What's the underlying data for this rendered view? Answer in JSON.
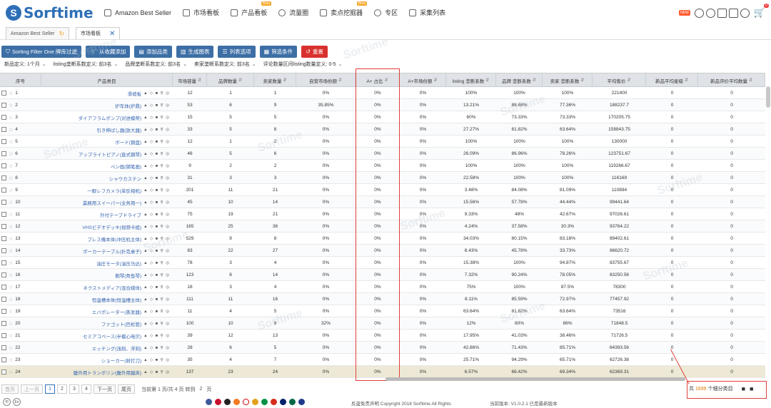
{
  "app": {
    "logo": "Sorftime"
  },
  "nav": [
    {
      "label": "Amazon Best Seller",
      "beta": ""
    },
    {
      "label": "市场看板",
      "beta": ""
    },
    {
      "label": "产品看板",
      "beta": "Beta"
    },
    {
      "label": "流量圈",
      "beta": ""
    },
    {
      "label": "卖点挖掘器",
      "beta": "Beta"
    },
    {
      "label": "专区",
      "beta": ""
    },
    {
      "label": "采集列表",
      "beta": ""
    }
  ],
  "top_right": {
    "new_badge": "NEW",
    "cart_count": "0"
  },
  "tabs": [
    {
      "label": "Amazon Best Seller"
    },
    {
      "label": "市场看板"
    }
  ],
  "toolbar": [
    {
      "label": "Sorting Filter One 牌库过滤",
      "icon": "funnel-icon"
    },
    {
      "label": "从收藏添加",
      "icon": "cart-icon"
    },
    {
      "label": "添加品类",
      "icon": "list-icon"
    },
    {
      "label": "生成图表",
      "icon": "chart-icon"
    },
    {
      "label": "列表选项",
      "icon": "list-icon"
    },
    {
      "label": "筛选条件",
      "icon": "filter-icon"
    },
    {
      "label": "重置",
      "icon": "reset-icon"
    }
  ],
  "filters": [
    {
      "label": "新品定义:",
      "value": "1个月"
    },
    {
      "label": "listing垄断系数定义:",
      "value": "前3名"
    },
    {
      "label": "品牌垄断系数定义:",
      "value": "前3名"
    },
    {
      "label": "卖家垄断系数定义:",
      "value": "前3名"
    },
    {
      "label": "评论数量区间listing数量定义:",
      "value": "0-5"
    }
  ],
  "columns": [
    "序号",
    "产品类目",
    "市场容量",
    "品牌数量",
    "卖家数量",
    "自营市场份额",
    "A+ 占比",
    "A+市场份额",
    "listing 垄断系数",
    "品牌 垄断系数",
    "卖家 垄断系数",
    "平均售价",
    "新品平均星级",
    "新品评价平均数量"
  ],
  "rows": [
    [
      "1",
      "滑坡板",
      "12",
      "1",
      "1",
      "0%",
      "0%",
      "0%",
      "100%",
      "100%",
      "100%",
      "221400",
      "0",
      "0"
    ],
    [
      "2",
      "炉车体(炉鼎)",
      "53",
      "6",
      "9",
      "35.85%",
      "0%",
      "0%",
      "13.21%",
      "88.68%",
      "77.36%",
      "188237.7",
      "0",
      "0"
    ],
    [
      "3",
      "ダイアフラムポンプ(对进模帮)",
      "15",
      "5",
      "5",
      "0%",
      "0%",
      "0%",
      "60%",
      "73.33%",
      "73.33%",
      "170205.75",
      "0",
      "0"
    ],
    [
      "4",
      "引き伸ばし器(放大器)",
      "33",
      "5",
      "8",
      "0%",
      "0%",
      "0%",
      "27.27%",
      "81.82%",
      "63.64%",
      "158843.75",
      "0",
      "0"
    ],
    [
      "5",
      "ボード(钢盘)",
      "12",
      "1",
      "2",
      "0%",
      "0%",
      "0%",
      "100%",
      "100%",
      "100%",
      "130000",
      "0",
      "0"
    ],
    [
      "6",
      "アップライトピアノ(直式钢琴)",
      "46",
      "5",
      "6",
      "0%",
      "0%",
      "0%",
      "26.09%",
      "86.96%",
      "78.26%",
      "123751.67",
      "0",
      "0"
    ],
    [
      "7",
      "ペン画(钢笔画)",
      "9",
      "2",
      "2",
      "0%",
      "0%",
      "0%",
      "100%",
      "100%",
      "100%",
      "119266.67",
      "0",
      "0"
    ],
    [
      "8",
      "シャウカステン",
      "31",
      "3",
      "3",
      "0%",
      "0%",
      "0%",
      "22.58%",
      "100%",
      "100%",
      "116169",
      "0",
      "0"
    ],
    [
      "9",
      "一眼レフカメラ(单反相机)",
      "201",
      "11",
      "21",
      "0%",
      "0%",
      "0%",
      "3.48%",
      "84.08%",
      "81.09%",
      "110894",
      "0",
      "0"
    ],
    [
      "10",
      "業務用スイーパー(业务用一)",
      "45",
      "10",
      "14",
      "0%",
      "0%",
      "0%",
      "15.56%",
      "57.78%",
      "44.44%",
      "99441.64",
      "0",
      "0"
    ],
    [
      "11",
      "外付テープドライブ",
      "75",
      "19",
      "21",
      "0%",
      "0%",
      "0%",
      "9.33%",
      "48%",
      "42.67%",
      "97026.61",
      "0",
      "0"
    ],
    [
      "12",
      "VHSビデオデッキ(视频卡组)",
      "165",
      "25",
      "36",
      "0%",
      "0%",
      "0%",
      "4.24%",
      "37.58%",
      "30.3%",
      "93764.22",
      "0",
      "0"
    ],
    [
      "13",
      "プレス機本体(冲压机主体)",
      "529",
      "9",
      "8",
      "0%",
      "0%",
      "0%",
      "34.03%",
      "80.15%",
      "83.18%",
      "89402.61",
      "0",
      "0"
    ],
    [
      "14",
      "ポーカーテーブル(扑克桌子)",
      "83",
      "22",
      "27",
      "0%",
      "0%",
      "0%",
      "8.43%",
      "45.78%",
      "33.73%",
      "86620.72",
      "0",
      "0"
    ],
    [
      "15",
      "油圧モータ(油压马达)",
      "78",
      "3",
      "4",
      "0%",
      "0%",
      "0%",
      "15.38%",
      "100%",
      "94.87%",
      "83755.67",
      "0",
      "0"
    ],
    [
      "16",
      "鞄琴(骨鱼琴)",
      "123",
      "8",
      "14",
      "0%",
      "0%",
      "0%",
      "7.32%",
      "90.24%",
      "78.05%",
      "83250.56",
      "0",
      "0"
    ],
    [
      "17",
      "ネクストメディア(混合媒体)",
      "18",
      "3",
      "4",
      "0%",
      "0%",
      "0%",
      "75%",
      "100%",
      "87.5%",
      "78300",
      "0",
      "0"
    ],
    [
      "18",
      "恒温槽本体(恒温槽主体)",
      "111",
      "11",
      "16",
      "0%",
      "0%",
      "0%",
      "8.11%",
      "85.59%",
      "72.97%",
      "77457.92",
      "0",
      "0"
    ],
    [
      "19",
      "エバポレーター(蒸发器)",
      "11",
      "4",
      "5",
      "0%",
      "0%",
      "0%",
      "63.64%",
      "81.82%",
      "63.64%",
      "73516",
      "0",
      "0"
    ],
    [
      "20",
      "ファゴット(巴松管)",
      "100",
      "10",
      "9",
      "32%",
      "0%",
      "0%",
      "12%",
      "80%",
      "86%",
      "71848.5",
      "0",
      "0"
    ],
    [
      "21",
      "セミアコベース(半模心电贝)",
      "39",
      "12",
      "13",
      "0%",
      "0%",
      "0%",
      "17.95%",
      "41.03%",
      "38.46%",
      "71726.5",
      "0",
      "0"
    ],
    [
      "22",
      "エッチング(浅刻、浮刻)",
      "28",
      "6",
      "5",
      "0%",
      "0%",
      "0%",
      "42.86%",
      "71.43%",
      "85.71%",
      "64393.56",
      "0",
      "0"
    ],
    [
      "23",
      "ショーカー(射打刀)",
      "35",
      "4",
      "7",
      "0%",
      "0%",
      "0%",
      "25.71%",
      "94.29%",
      "65.71%",
      "62726.38",
      "0",
      "0"
    ],
    [
      "24",
      "腹外用トランポリン(腹外用蹦床)",
      "137",
      "23",
      "24",
      "0%",
      "0%",
      "0%",
      "6.57%",
      "66.42%",
      "69.34%",
      "62369.31",
      "0",
      "0"
    ]
  ],
  "pager": {
    "first": "首页",
    "prev": "上一页",
    "pages": [
      "1",
      "2",
      "3",
      "4"
    ],
    "next": "下一页",
    "last": "尾页",
    "info": "当前第 1 页/共 4 页 转到",
    "goto_value": "2",
    "goto_suffix": "页"
  },
  "summary": {
    "prefix": "共",
    "count": "1699",
    "suffix": "个细分类目"
  },
  "footer": {
    "lang_zh": "中",
    "lang_en": "En",
    "copyright": "反盗免责声明 Copyright 2018 Sorftime All Rights",
    "version": "当前版本: V1.0.2.1  已是最新版本"
  },
  "watermark": "Sorftime"
}
